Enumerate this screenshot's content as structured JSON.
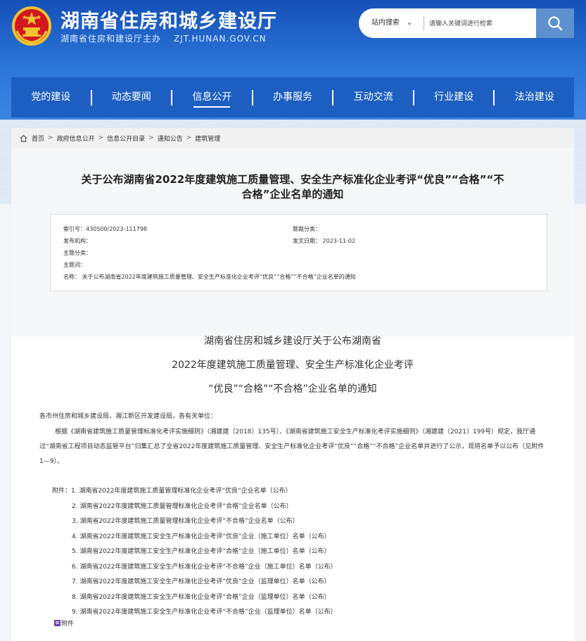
{
  "header": {
    "title": "湖南省住房和城乡建设厅",
    "subtitle": "湖南省住房和建设厅主办",
    "domain": "ZJT.HUNAN.GOV.CN"
  },
  "search": {
    "scope_label": "站内搜索",
    "placeholder": "请输入关键词进行检索"
  },
  "nav": {
    "items": [
      {
        "label": "党的建设"
      },
      {
        "label": "动态要闻"
      },
      {
        "label": "信息公开"
      },
      {
        "label": "办事服务"
      },
      {
        "label": "互动交流"
      },
      {
        "label": "行业建设"
      },
      {
        "label": "法治建设"
      }
    ],
    "active_index": 2
  },
  "breadcrumb": [
    "首页",
    "政府信息公开",
    "信息公开目录",
    "通知公告",
    "建筑管理"
  ],
  "document": {
    "title_line1": "关于公布湖南省2022年度建筑施工质量管理、安全生产标准化企业考评“优良”“合格”“不",
    "title_line2": "合格”企业名单的通知",
    "meta": {
      "index_no": "索引号：430S00/2023-111798",
      "category": "题裁分类：",
      "publisher": "发布机构：",
      "issue_date": "发文日期：  2023-11-02",
      "topic": "主题分类：",
      "keywords": "主题词：",
      "name": "名称：  关于公布湖南省2022年度建筑施工质量管理、安全生产标准化企业考评“优良”“合格”“不合格”企业名单的通知"
    },
    "article_title": [
      "湖南省住房和城乡建设厅关于公布湖南省",
      "2022年度建筑施工质量管理、安全生产标准化企业考评",
      "“优良”“合格”“不合格”企业名单的通知"
    ],
    "salutation": "各市州住房和城乡建设局，湘江新区开发建设局，各有关单位：",
    "paragraph": "根据《湖南省建筑施工质量管理标准化考评实施细则》（湘建建〔2018〕135号）、《湖南省建筑施工安全生产标准化考评实施细则》（湘建建〔2021〕199号）规定，我厅通过“湖南省工程项目动态监管平台”归集汇总了全省2022年度建筑施工质量管理、安全生产标准化企业考评“优良”“合格”“不合格”企业名单并进行了公示，现将名单予以公布（见附件1—9）。",
    "attachments": [
      "附件：1. 湖南省2022年度建筑施工质量管理标准化企业考评“优良”企业名单（公布）",
      "2. 湖南省2022年度建筑施工质量管理标准化企业考评“合格”企业名单（公布）",
      "3. 湖南省2022年度建筑施工质量管理标准化企业考评“不合格”企业名单（公布）",
      "4. 湖南省2022年度建筑施工安全生产标准化企业考评“优良”企业（施工单位）名单（公布）",
      "5. 湖南省2022年度建筑施工安全生产标准化企业考评“合格”企业（施工单位）名单（公布）",
      "6. 湖南省2022年度建筑施工安全生产标准化企业考评“不合格”企业（施工单位）名单（公布）",
      "7. 湖南省2022年度建筑施工安全生产标准化企业考评“优良”企业（监理单位）名单（公布）",
      "8. 湖南省2022年度建筑施工安全生产标准化企业考评“合格”企业（监理单位）名单（公布）",
      "9. 湖南省2022年度建筑施工安全生产标准化企业考评“不合格”企业（监理单位）名单（公布）"
    ],
    "attachment_footer": "附件"
  },
  "colors": {
    "brand_blue": "#1d5fc0",
    "search_button": "#5e8fcf",
    "emblem_red": "#d2171f",
    "emblem_gold": "#f2c230"
  }
}
